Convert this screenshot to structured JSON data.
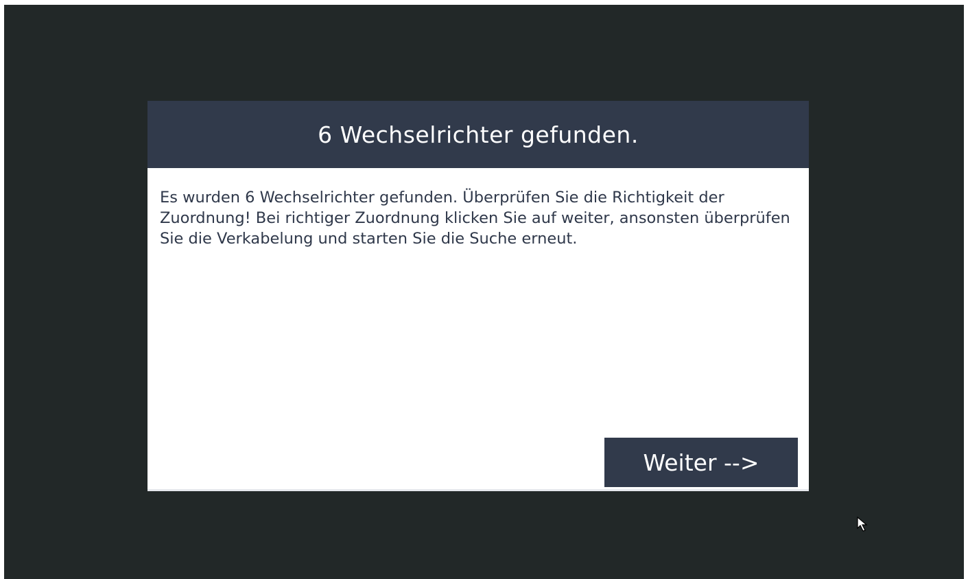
{
  "dialog": {
    "title": "6 Wechselrichter gefunden.",
    "message": "Es wurden 6 Wechselrichter gefunden. Überprüfen Sie die Richtigkeit der Zuordnung! Bei richtiger Zuordnung klicken Sie auf weiter, ansonsten überprüfen Sie die Verkabelung und starten Sie die Suche erneut.",
    "next_button_label": "Weiter -->"
  },
  "colors": {
    "screen_background": "#222828",
    "header_background": "#313a4b",
    "button_background": "#313a4b",
    "body_text": "#2f384a"
  },
  "icons": {
    "cursor": "mouse-pointer-icon"
  }
}
